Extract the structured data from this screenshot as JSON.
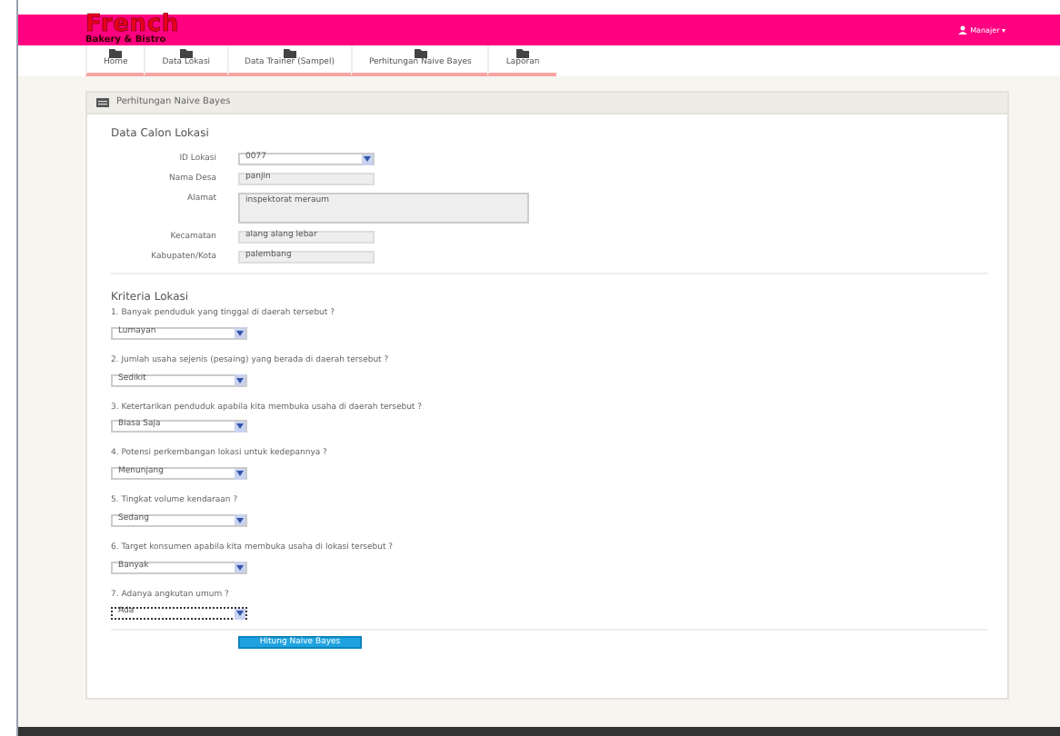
{
  "header": {
    "logo_title": "French",
    "logo_subtitle": "Bakery & Bistro",
    "user_menu": "Manajer ▾"
  },
  "nav": [
    {
      "label": "Home"
    },
    {
      "label": "Data Lokasi"
    },
    {
      "label": "Data Trainer (Sampel)"
    },
    {
      "label": "Perhitungan Naive Bayes"
    },
    {
      "label": "Laporan"
    }
  ],
  "panel": {
    "title": "Perhitungan Naive Bayes",
    "location_section": {
      "heading": "Data Calon Lokasi",
      "fields": [
        {
          "label": "ID Lokasi",
          "kind": "select",
          "value": "0077"
        },
        {
          "label": "Nama Desa",
          "kind": "input",
          "value": "panjin"
        },
        {
          "label": "Alamat",
          "kind": "textarea",
          "value": "inspektorat meraum"
        },
        {
          "label": "Kecamatan",
          "kind": "input",
          "value": "alang alang lebar"
        },
        {
          "label": "Kabupaten/Kota",
          "kind": "input",
          "value": "palembang"
        }
      ]
    },
    "criteria_section": {
      "heading": "Kriteria Lokasi",
      "questions": [
        {
          "question": "1. Banyak penduduk yang tinggal di daerah tersebut ?",
          "answer": "Lumayan",
          "focused": false
        },
        {
          "question": "2. Jumlah usaha sejenis (pesaing) yang berada di daerah tersebut ?",
          "answer": "Sedikit",
          "focused": false
        },
        {
          "question": "3. Ketertarikan penduduk apabila kita membuka usaha di daerah tersebut ?",
          "answer": "Biasa Saja",
          "focused": false
        },
        {
          "question": "4. Potensi perkembangan lokasi untuk kedepannya ?",
          "answer": "Menunjang",
          "focused": false
        },
        {
          "question": "5. Tingkat volume kendaraan ?",
          "answer": "Sedang",
          "focused": false
        },
        {
          "question": "6. Target konsumen apabila kita membuka usaha di lokasi tersebut ?",
          "answer": "Banyak",
          "focused": false
        },
        {
          "question": "7. Adanya angkutan umum ?",
          "answer": "Ada",
          "focused": true
        }
      ]
    },
    "submit_button": "Hitung Naive Bayes"
  }
}
